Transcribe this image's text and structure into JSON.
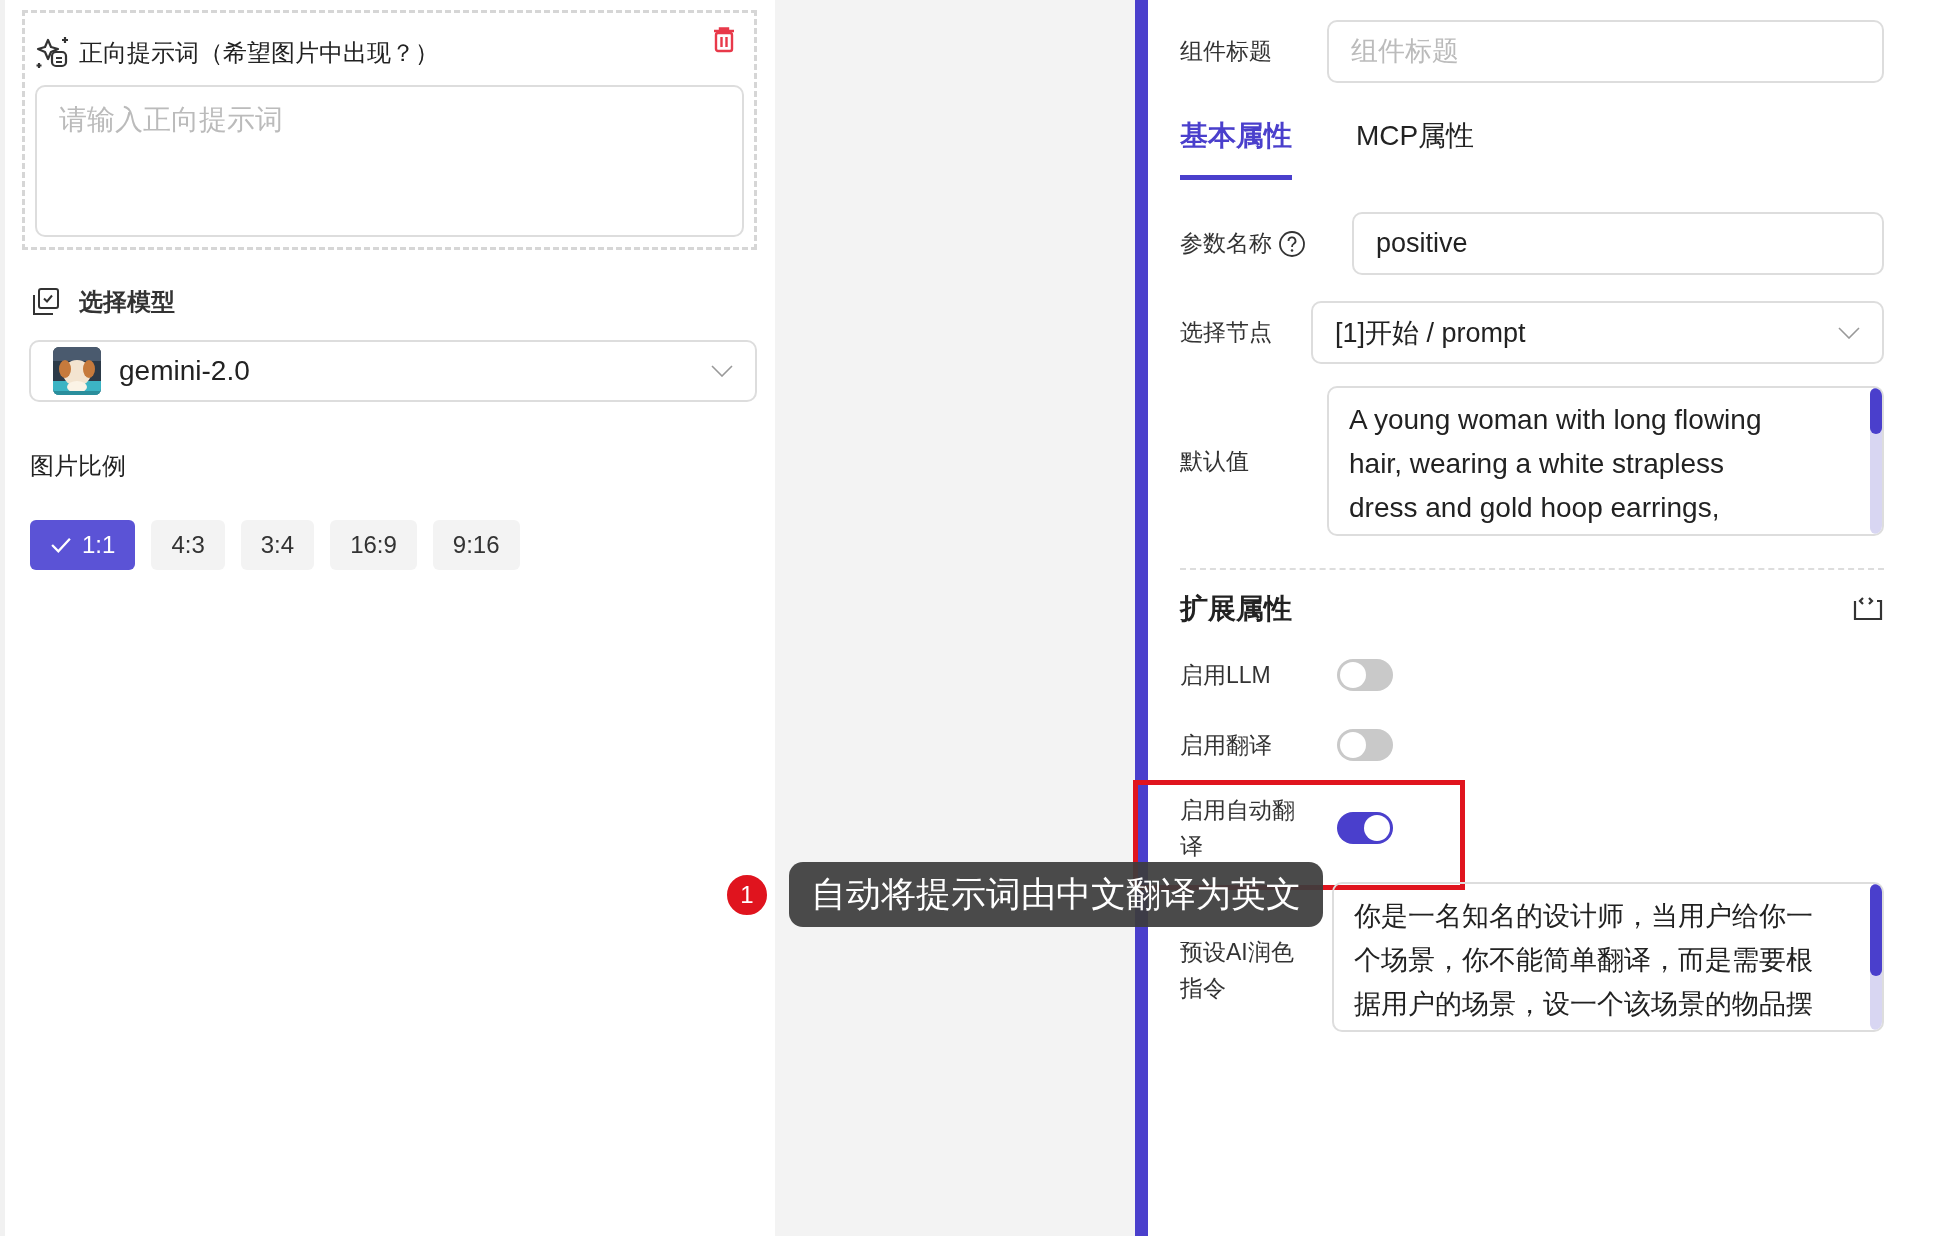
{
  "prompt_block": {
    "title": "正向提示词（希望图片中出现？）",
    "placeholder": "请输入正向提示词"
  },
  "model": {
    "label": "选择模型",
    "value": "gemini-2.0"
  },
  "ratio": {
    "label": "图片比例",
    "options": [
      {
        "label": "1:1",
        "selected": true
      },
      {
        "label": "4:3",
        "selected": false
      },
      {
        "label": "3:4",
        "selected": false
      },
      {
        "label": "16:9",
        "selected": false
      },
      {
        "label": "9:16",
        "selected": false
      }
    ]
  },
  "properties": {
    "title_label": "组件标题",
    "title_placeholder": "组件标题",
    "tabs": [
      {
        "label": "基本属性",
        "selected": true
      },
      {
        "label": "MCP属性",
        "selected": false
      }
    ],
    "fields": [
      {
        "kind": "input",
        "label": "参数名称",
        "help": true,
        "value": "positive"
      },
      {
        "kind": "select",
        "label": "选择节点",
        "value": "[1]开始 / prompt"
      },
      {
        "kind": "textarea",
        "label": "默认值",
        "lines": [
          "A young woman with long flowing",
          "hair, wearing a white strapless",
          "dress and gold hoop earrings,"
        ]
      }
    ]
  },
  "extended": {
    "title": "扩展属性",
    "items": [
      {
        "kind": "toggle",
        "label": "启用LLM",
        "on": false,
        "highlighted": false
      },
      {
        "kind": "toggle",
        "label": "启用翻译",
        "on": false,
        "highlighted": false
      },
      {
        "kind": "toggle",
        "label": "启用自动翻译",
        "on": true,
        "highlighted": true
      },
      {
        "kind": "textarea",
        "label": "预设AI润色指令",
        "lines": [
          "你是一名知名的设计师，当用户给你一",
          "个场景，你不能简单翻译，而是需要根",
          "据用户的场景，设一个该场景的物品摆"
        ]
      }
    ]
  },
  "annotation": {
    "number": "1",
    "text": "自动将提示词由中文翻译为英文"
  }
}
